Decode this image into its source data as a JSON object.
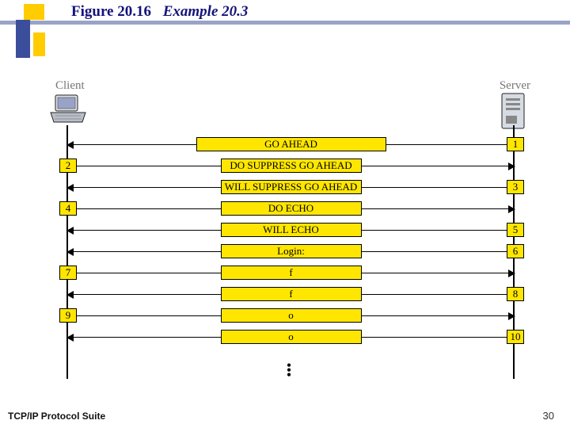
{
  "title": {
    "figure": "Figure 20.16",
    "example": "Example 20.3"
  },
  "endpoints": {
    "client": "Client",
    "server": "Server"
  },
  "messages": [
    {
      "seq": 1,
      "dir": "s2c",
      "text": "GO AHEAD"
    },
    {
      "seq": 2,
      "dir": "c2s",
      "text": "DO SUPPRESS GO AHEAD"
    },
    {
      "seq": 3,
      "dir": "s2c",
      "text": "WILL SUPPRESS GO AHEAD"
    },
    {
      "seq": 4,
      "dir": "c2s",
      "text": "DO ECHO"
    },
    {
      "seq": 5,
      "dir": "s2c",
      "text": "WILL ECHO"
    },
    {
      "seq": 6,
      "dir": "s2c",
      "text": "Login:"
    },
    {
      "seq": 7,
      "dir": "c2s",
      "text": "f"
    },
    {
      "seq": 8,
      "dir": "s2c",
      "text": "f"
    },
    {
      "seq": 9,
      "dir": "c2s",
      "text": "o"
    },
    {
      "seq": 10,
      "dir": "s2c",
      "text": "o"
    }
  ],
  "footer": "TCP/IP Protocol Suite",
  "page": "30"
}
